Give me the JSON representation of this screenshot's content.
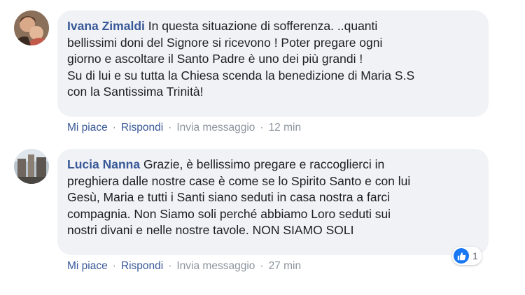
{
  "comments": [
    {
      "author": "Ivana Zimaldi",
      "text": "In questa situazione di sofferenza. ..quanti\nbellissimi doni del Signore si ricevono ! Poter pregare ogni\ngiorno e ascoltare il Santo Padre è uno dei più grandi !\nSu di lui e su tutta la Chiesa scenda la benedizione di Maria S.S\ncon la Santissima Trinità!",
      "like_label": "Mi piace",
      "reply_label": "Rispondi",
      "message_label": "Invia messaggio",
      "time": "12 min"
    },
    {
      "author": "Lucia Nanna",
      "text": "Grazie, è bellissimo pregare e raccoglierci in\npreghiera dalle nostre case è come se lo Spirito Santo e con lui\nGesù, Maria e tutti i Santi siano seduti in casa nostra a farci\ncompagnia. Non Siamo soli perché abbiamo Loro seduti sui\nnostri divani e nelle nostre tavole. NON SIAMO SOLI",
      "like_label": "Mi piace",
      "reply_label": "Rispondi",
      "message_label": "Invia messaggio",
      "time": "27 min",
      "reaction_count": "1"
    }
  ],
  "colors": {
    "author": "#385898",
    "bubble": "#f0f2f5",
    "like_reaction": "#1877f2"
  },
  "icons": {
    "separator": "·",
    "reaction": "thumbs-up-icon"
  }
}
